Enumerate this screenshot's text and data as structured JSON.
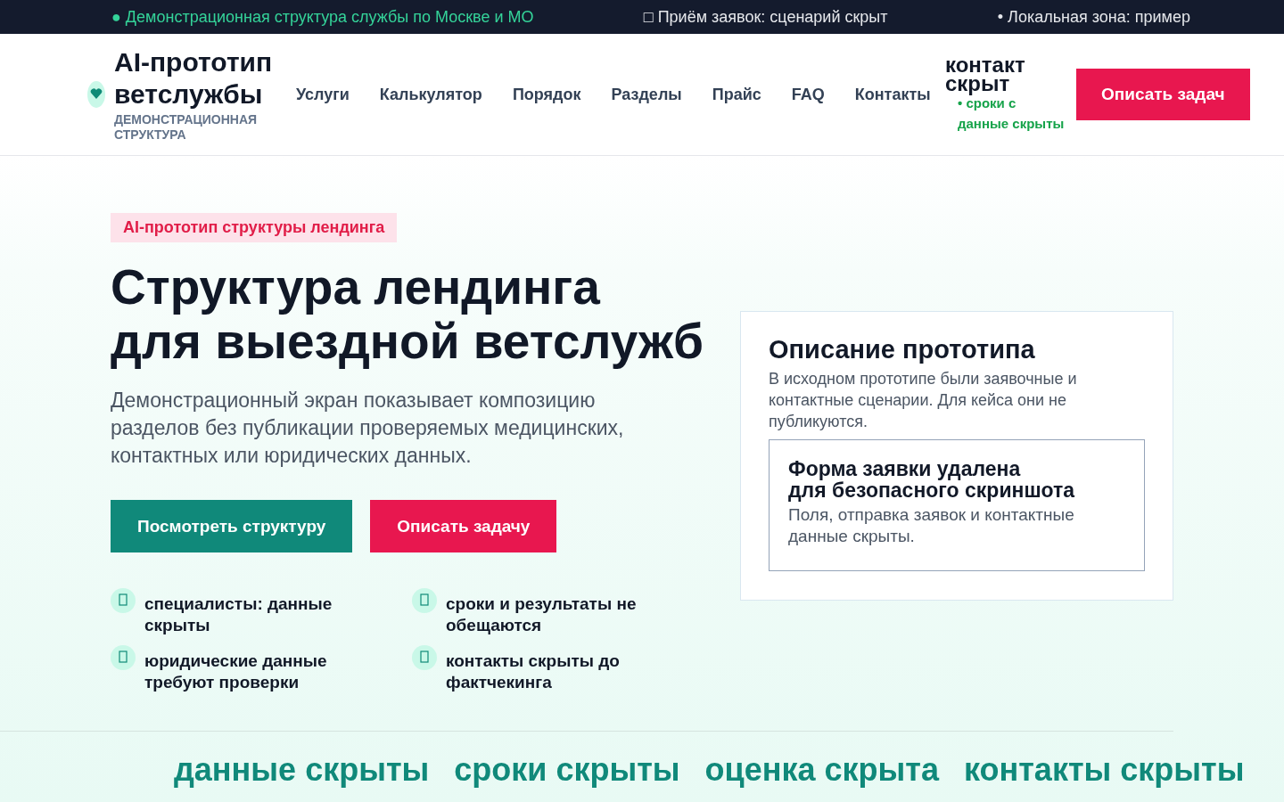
{
  "top_bar": [
    {
      "text": "● Демонстрационная структура службы по Москве и МО",
      "kind": "accent"
    },
    {
      "text": "□ Приём заявок: сценарий скрыт",
      "kind": "plain"
    },
    {
      "text": "• Локальная зона: пример",
      "kind": "plain"
    }
  ],
  "header": {
    "logo_title": "AI-прототип ветслужбы",
    "logo_subtitle": "ДЕМОНСТРАЦИОННАЯ СТРУКТУРА",
    "nav": [
      "Услуги",
      "Калькулятор",
      "Порядок",
      "Разделы",
      "Прайс",
      "FAQ",
      "Контакты"
    ],
    "status_title": "контакт скрыт",
    "status_lines": [
      "• сроки с",
      "данные скрыты"
    ],
    "cta": "Описать задач"
  },
  "hero": {
    "badge": "AI-прототип структуры лендинга",
    "title_lines": [
      "Структура лендинга",
      "для выездной ветслужб"
    ],
    "lead": "Демонстрационный экран показывает композицию разделов без публикации проверяемых медицинских, контактных или юридических данных.",
    "buttons": [
      {
        "label": "Посмотреть структуру",
        "kind": "primary"
      },
      {
        "label": "Описать задачу",
        "kind": "accent"
      }
    ],
    "features": [
      "специалисты: данные скрыты",
      "сроки и результаты не обещаются",
      "юридические данные требуют проверки",
      "контакты скрыты до фактчекинга"
    ]
  },
  "card": {
    "title": "Описание прототипа",
    "text": "В исходном прототипе были заявочные и контактные сценарии. Для кейса они не публикуются.",
    "notice_title_lines": [
      "Форма заявки удалена",
      "для безопасного скриншота"
    ],
    "notice_text": "Поля, отправка заявок и контактные данные скрыты."
  },
  "stats": [
    "данные скрыты",
    "сроки скрыты",
    "оценка скрыта",
    "контакты скрыты"
  ]
}
